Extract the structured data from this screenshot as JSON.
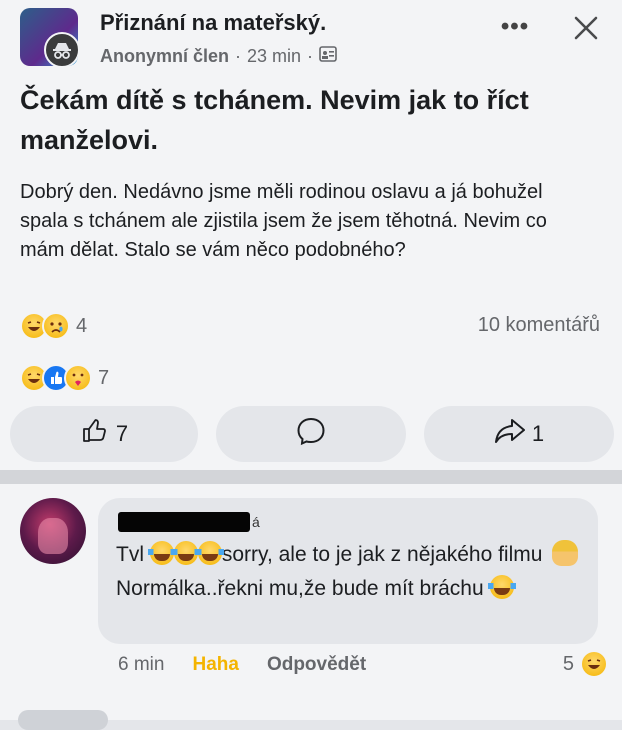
{
  "post": {
    "group_name": "Přiznání na mateřský.",
    "author": "Anonymní člen",
    "separator": "·",
    "time": "23 min",
    "title": "Čekám dítě s tchánem. Nevim jak to říct manželovi.",
    "body": "Dobrý den. Nedávno jsme měli rodinou oslavu a já bohužel spala s tchánem ale zjistila jsem že jsem těhotná. Nevim co mám dělat. Stalo se vám něco podobného?",
    "reaction_count": "4",
    "comments_label": "10 komentářů",
    "reaction_count_2": "7"
  },
  "actions": {
    "like_count": "7",
    "share_count": "1"
  },
  "comment": {
    "name_tail": "á",
    "text_1": "Tvl",
    "text_2": "sorry, ale to je jak z nějakého filmu",
    "text_3": "Normálka..řekni mu,že bude mít bráchu",
    "time": "6 min",
    "haha": "Haha",
    "reply": "Odpovědět",
    "reaction_count": "5"
  },
  "colors": {
    "accent": "#1877f2",
    "haha": "#f4b400",
    "secondary_text": "#65676b"
  },
  "icons": [
    "group-avatar",
    "anonymous-icon",
    "globe-icon",
    "more-icon",
    "close-icon",
    "like-icon",
    "comment-icon",
    "share-icon",
    "haha-emoji",
    "sad-emoji",
    "care-emoji",
    "like-emoji"
  ]
}
